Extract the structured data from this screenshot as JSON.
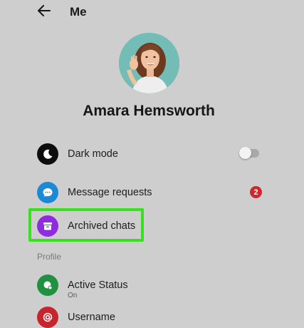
{
  "header": {
    "back_icon": "arrow-left-icon",
    "title": "Me"
  },
  "profile": {
    "name": "Amara Hemsworth"
  },
  "settings": {
    "dark_mode": {
      "label": "Dark mode",
      "icon": "moon-icon",
      "enabled": false
    },
    "message_requests": {
      "label": "Message requests",
      "icon": "chat-bubble-icon",
      "badge": "2"
    },
    "archived_chats": {
      "label": "Archived chats",
      "icon": "archive-box-icon",
      "highlighted": true
    }
  },
  "profile_section": {
    "header": "Profile",
    "active_status": {
      "label": "Active Status",
      "value": "On",
      "icon": "active-status-icon"
    },
    "username": {
      "label": "Username",
      "icon": "at-sign-icon"
    }
  },
  "colors": {
    "background": "#cecece",
    "dark_mode_icon_bg": "#0d0d0d",
    "message_icon_bg": "#1a8ad6",
    "archived_icon_bg": "#8f2ce0",
    "active_status_icon_bg": "#1f9140",
    "username_icon_bg": "#c8242e",
    "badge": "#d1262c",
    "highlight_border": "#38e01f"
  }
}
